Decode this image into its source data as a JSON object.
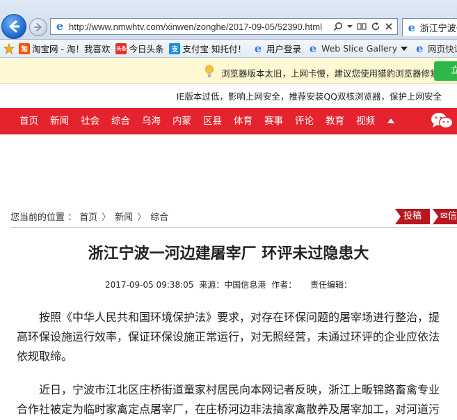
{
  "browser": {
    "url": "http://www.nmwhtv.com/xinwen/zonghe/2017-09-05/52390.html",
    "tab_title": "浙江宁波一",
    "favorites": [
      {
        "label": "淘宝网 - 淘！我喜欢",
        "icon": "taobao-icon",
        "color": "#ff5000"
      },
      {
        "label": "今日头条",
        "icon": "toutiao-icon",
        "color": "#e8312c"
      },
      {
        "label": "支付宝 知托付！",
        "icon": "alipay-icon",
        "color": "#1a8fe3"
      },
      {
        "label": "用户登录",
        "icon": "ie-page-icon",
        "color": "#2b7be0"
      },
      {
        "label": "Web Slice Gallery",
        "icon": "ie-page-icon",
        "color": "#2b7be0"
      },
      {
        "label": "网页快讯库",
        "icon": "ie-page-icon",
        "color": "#2b7be0"
      }
    ],
    "infobar_text": "浏览器版本太旧，上网卡慢，建议您使用猎豹浏览器修复",
    "infobar_button": "立"
  },
  "page": {
    "ie_warning": "IE版本过低，影响上网安全，推荐安装QQ双核浏览器，保护上网安全",
    "nav": [
      "首页",
      "新闻",
      "社会",
      "综合",
      "乌海",
      "内蒙",
      "区县",
      "体育",
      "赛事",
      "评论",
      "教育",
      "视频"
    ],
    "breadcrumb": {
      "prefix": "您当前的位置 ：",
      "items": [
        "首页",
        "新闻",
        "综合"
      ]
    },
    "submit_label": "投稿",
    "mail_label": "信",
    "article": {
      "title": "浙江宁波一河边建屠宰厂  环评未过隐患大",
      "datetime": "2017-09-05 09:38:05",
      "source_label": "来源：",
      "source": "中国信息港",
      "author_label": "作者：",
      "editor_label": "责任编辑：",
      "para1": "按照《中华人民共和国环境保护法》要求，对存在环保问题的屠宰场进行整治，提高环保设施运行效率，保证环保设施正常运行，对无照经营，未通过环评的企业应依法依规取缔。",
      "para2": "近日，宁波市江北区庄桥街道童家村居民向本网记者反映，浙江上畈锦路畜禽专业合作社被定为临时家禽定点屠宰厂，在庄桥河边非法搞家禽散养及屠宰加工，对河道污"
    }
  }
}
